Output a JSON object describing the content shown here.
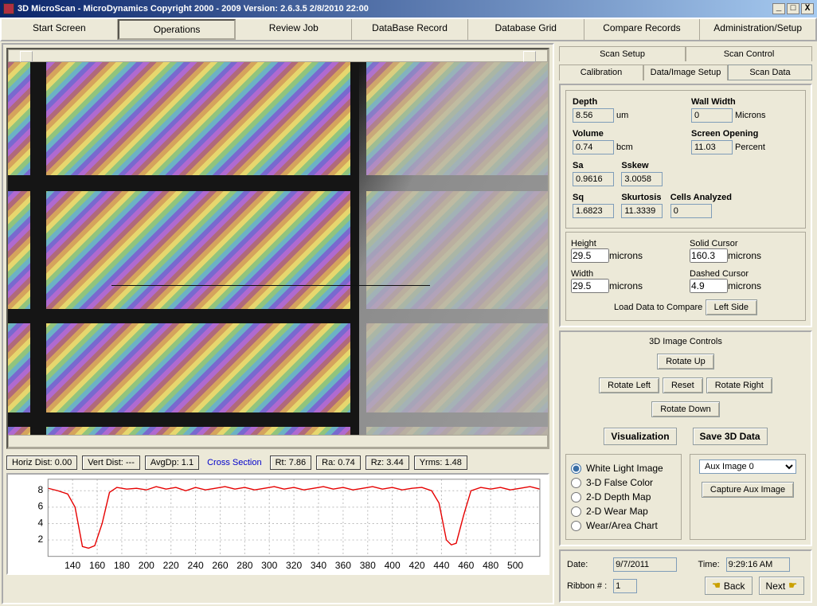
{
  "title": "3D MicroScan  -  MicroDynamics  Copyright 2000 - 2009  Version: 2.6.3.5    2/8/2010  22:00",
  "menus": [
    "Start Screen",
    "Operations",
    "Review Job",
    "DataBase Record",
    "Database Grid",
    "Compare Records",
    "Administration/Setup"
  ],
  "metrics": {
    "horiz": "Horiz Dist: 0.00",
    "vert": "Vert Dist: ---",
    "avg": "AvgDp: 1.1",
    "xsection": "Cross Section",
    "rt": "Rt: 7.86",
    "ra": "Ra: 0.74",
    "rz": "Rz: 3.44",
    "yrms": "Yrms: 1.48"
  },
  "tabs1": [
    "Scan Setup",
    "Scan Control"
  ],
  "tabs2": [
    "Calibration",
    "Data/Image Setup",
    "Scan Data"
  ],
  "scan": {
    "depth_label": "Depth",
    "depth": "8.56",
    "depth_unit": "um",
    "wall_label": "Wall Width",
    "wall": "0",
    "wall_unit": "Microns",
    "vol_label": "Volume",
    "vol": "0.74",
    "vol_unit": "bcm",
    "open_label": "Screen Opening",
    "open": "11.03",
    "open_unit": "Percent",
    "sa_label": "Sa",
    "sa": "0.9616",
    "sskew_label": "Sskew",
    "sskew": "3.0058",
    "sq_label": "Sq",
    "sq": "1.6823",
    "skurt_label": "Skurtosis",
    "skurt": "11.3339",
    "cells_label": "Cells Analyzed",
    "cells": "0"
  },
  "cursor": {
    "height_label": "Height",
    "height": "29.5",
    "h_unit": "microns",
    "solid_label": "Solid Cursor",
    "solid": "160.3",
    "s_unit": "microns",
    "width_label": "Width",
    "width": "29.5",
    "w_unit": "microns",
    "dashed_label": "Dashed Cursor",
    "dashed": "4.9",
    "d_unit": "microns",
    "load": "Load Data to Compare",
    "side": "Left Side"
  },
  "controls": {
    "title": "3D Image Controls",
    "up": "Rotate Up",
    "down": "Rotate Down",
    "left": "Rotate Left",
    "right": "Rotate Right",
    "reset": "Reset",
    "vis": "Visualization",
    "save3d": "Save 3D Data",
    "r1": "White Light Image",
    "r2": "3-D False Color",
    "r3": "2-D Depth Map",
    "r4": "2-D Wear Map",
    "r5": "Wear/Area Chart",
    "aux": "Aux Image 0",
    "capture": "Capture Aux Image"
  },
  "footer": {
    "date_label": "Date:",
    "date": "9/7/2011",
    "time_label": "Time:",
    "time": "9:29:16 AM",
    "ribbon_label": "Ribbon # :",
    "ribbon": "1",
    "back": "Back",
    "next": "Next"
  },
  "chart_data": {
    "type": "line",
    "xlabel": "",
    "ylabel": "",
    "xticks": [
      140,
      160,
      180,
      200,
      220,
      240,
      260,
      280,
      300,
      320,
      340,
      360,
      380,
      400,
      420,
      440,
      460,
      480,
      500
    ],
    "yticks": [
      2,
      4,
      6,
      8
    ],
    "xlim": [
      120,
      520
    ],
    "ylim": [
      0,
      9.4
    ],
    "series": [
      {
        "name": "depth",
        "color": "#e60000",
        "values": [
          [
            120,
            8.3
          ],
          [
            128,
            8.0
          ],
          [
            136,
            7.6
          ],
          [
            142,
            6.0
          ],
          [
            148,
            1.2
          ],
          [
            153,
            1.0
          ],
          [
            158,
            1.3
          ],
          [
            164,
            4.0
          ],
          [
            170,
            7.8
          ],
          [
            176,
            8.4
          ],
          [
            184,
            8.2
          ],
          [
            192,
            8.3
          ],
          [
            200,
            8.1
          ],
          [
            208,
            8.5
          ],
          [
            216,
            8.2
          ],
          [
            224,
            8.4
          ],
          [
            232,
            8.0
          ],
          [
            240,
            8.4
          ],
          [
            248,
            8.1
          ],
          [
            256,
            8.3
          ],
          [
            264,
            8.5
          ],
          [
            272,
            8.2
          ],
          [
            280,
            8.4
          ],
          [
            288,
            8.1
          ],
          [
            296,
            8.3
          ],
          [
            304,
            8.5
          ],
          [
            312,
            8.2
          ],
          [
            320,
            8.4
          ],
          [
            328,
            8.1
          ],
          [
            336,
            8.3
          ],
          [
            344,
            8.5
          ],
          [
            352,
            8.2
          ],
          [
            360,
            8.4
          ],
          [
            368,
            8.1
          ],
          [
            376,
            8.3
          ],
          [
            384,
            8.5
          ],
          [
            392,
            8.2
          ],
          [
            400,
            8.4
          ],
          [
            408,
            8.1
          ],
          [
            416,
            8.3
          ],
          [
            424,
            8.4
          ],
          [
            432,
            8.0
          ],
          [
            438,
            6.5
          ],
          [
            444,
            2.0
          ],
          [
            448,
            1.4
          ],
          [
            452,
            1.6
          ],
          [
            458,
            5.0
          ],
          [
            464,
            8.0
          ],
          [
            472,
            8.4
          ],
          [
            480,
            8.2
          ],
          [
            488,
            8.4
          ],
          [
            496,
            8.1
          ],
          [
            504,
            8.3
          ],
          [
            512,
            8.5
          ],
          [
            520,
            8.2
          ]
        ]
      }
    ]
  }
}
